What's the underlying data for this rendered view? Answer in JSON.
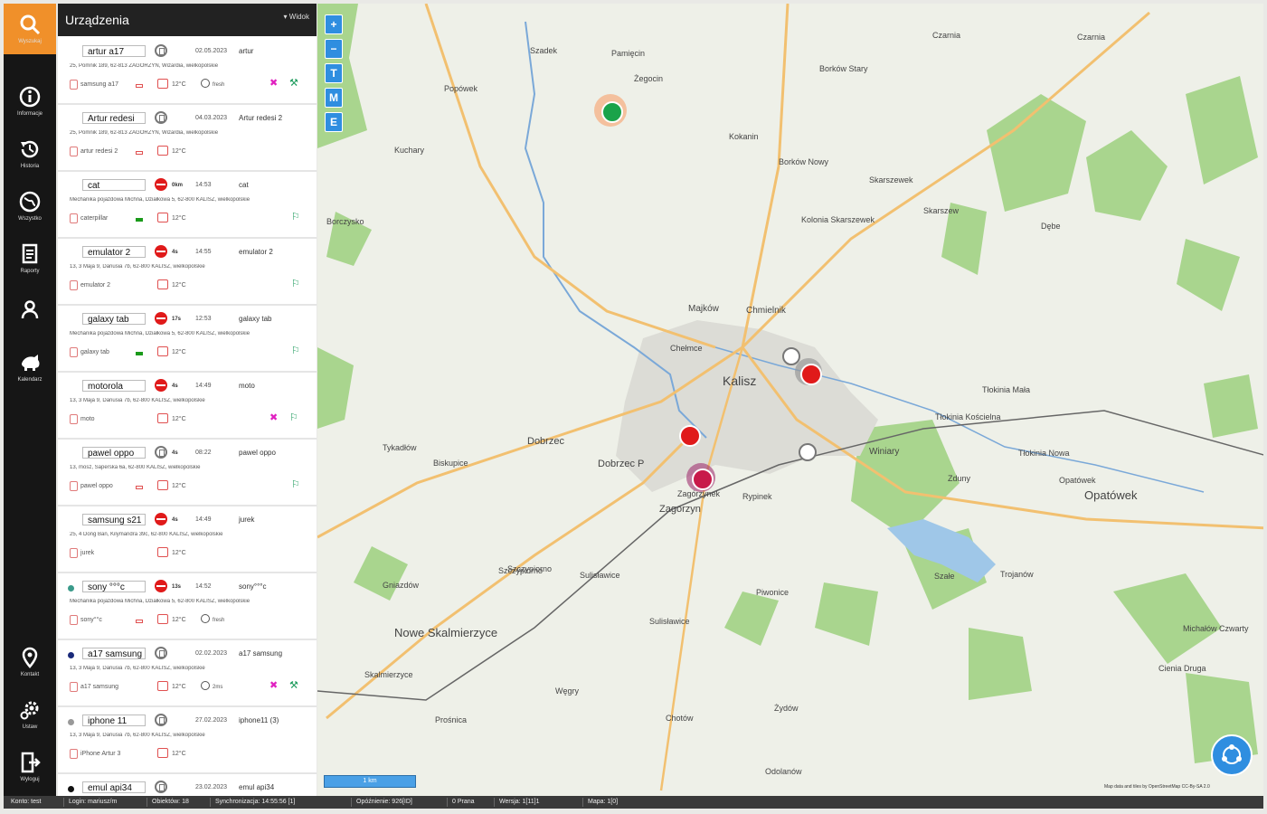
{
  "sidebar": {
    "items": [
      {
        "label": "Wyszukaj",
        "icon": "search-icon"
      },
      {
        "label": "Informacje",
        "icon": "info-icon"
      },
      {
        "label": "Historia",
        "icon": "history-icon"
      },
      {
        "label": "Wszystko",
        "icon": "globe-icon"
      },
      {
        "label": "Raporty",
        "icon": "report-icon"
      },
      {
        "label": "",
        "icon": "team-icon"
      },
      {
        "label": "Kalendarz",
        "icon": "calendar-icon"
      },
      {
        "label": "Kontakt",
        "icon": "marker-icon"
      },
      {
        "label": "Ustaw",
        "icon": "gear-icon"
      },
      {
        "label": "Wyloguj",
        "icon": "logout-icon"
      }
    ]
  },
  "panel": {
    "title": "Urządzenia",
    "view_label": "Widok"
  },
  "devices": [
    {
      "name": "artur a17",
      "time": "02.05.2023",
      "driver": "artur",
      "address": "25, Pomnik 189, 62-813 ZAGORZYN, Wizardia, wielkopolskie",
      "phone": "samsung a17",
      "temp": "12°C",
      "status": "gray",
      "battery": "red",
      "speed": "",
      "clock": "fresh",
      "dot": "",
      "tools": [
        "pin-x",
        "wrench-green"
      ]
    },
    {
      "name": "Artur redesi",
      "time": "04.03.2023",
      "driver": "Artur redesi 2",
      "address": "25, Pomnik 189, 62-813 ZAGORZYN, Wizardia, wielkopolskie",
      "phone": "artur redesi 2",
      "temp": "12°C",
      "status": "gray",
      "battery": "red",
      "speed": "",
      "clock": "",
      "dot": "",
      "tools": []
    },
    {
      "name": "cat",
      "time": "14:53",
      "driver": "cat",
      "address": "Mechanika pojazdowa Michna, Działkowa 5, 62-800 KALISZ, wielkopolskie",
      "phone": "caterpillar",
      "temp": "12°C",
      "status": "stop",
      "battery": "green",
      "speed": "0km",
      "clock": "",
      "dot": "",
      "tools": [
        "person-green"
      ]
    },
    {
      "name": "emulator 2",
      "time": "14:55",
      "driver": "emulator 2",
      "address": "13, 3 Maja 9, Danusia 7b, 62-800 KALISZ, wielkopolskie",
      "phone": "emulator 2",
      "temp": "12°C",
      "status": "stop",
      "battery": "",
      "speed": "4s",
      "clock": "",
      "dot": "",
      "tools": [
        "person-green"
      ]
    },
    {
      "name": "galaxy tab",
      "time": "12:53",
      "driver": "galaxy tab",
      "address": "Mechanika pojazdowa Michna, Działkowa 5, 62-800 KALISZ, wielkopolskie",
      "phone": "galaxy tab",
      "temp": "12°C",
      "status": "stop",
      "battery": "green",
      "speed": "17s",
      "clock": "",
      "dot": "",
      "tools": [
        "person-green"
      ]
    },
    {
      "name": "motorola",
      "time": "14:49",
      "driver": "moto",
      "address": "13, 3 Maja 9, Danusia 7b, 62-800 KALISZ, wielkopolskie",
      "phone": "moto",
      "temp": "12°C",
      "status": "stop",
      "battery": "",
      "speed": "4s",
      "clock": "",
      "dot": "",
      "tools": [
        "pin-x",
        "person-green"
      ]
    },
    {
      "name": "pawel oppo",
      "time": "08:22",
      "driver": "pawel oppo",
      "address": "13, mosz, Saperska 6a, 62-800 KALISZ, wielkopolskie",
      "phone": "pawel oppo",
      "temp": "12°C",
      "status": "gray",
      "battery": "red",
      "speed": "4s",
      "clock": "",
      "dot": "",
      "tools": [
        "person-green"
      ]
    },
    {
      "name": "samsung s21",
      "time": "14:49",
      "driver": "jurek",
      "address": "25, 4 Dong Ban, Kilymandra 39c, 62-800 KALISZ, wielkopolskie",
      "phone": "jurek",
      "temp": "12°C",
      "status": "stop",
      "battery": "",
      "speed": "4s",
      "clock": "",
      "dot": "",
      "tools": []
    },
    {
      "name": "sony °°°c",
      "time": "14:52",
      "driver": "sony°°°c",
      "address": "Mechanika pojazdowa Michna, Działkowa 5, 62-800 KALISZ, wielkopolskie",
      "phone": "sony°°c",
      "temp": "12°C",
      "status": "stop",
      "battery": "red",
      "speed": "13s",
      "clock": "fresh",
      "dot": "#3a9a8a",
      "tools": []
    },
    {
      "name": "a17 samsung",
      "time": "02.02.2023",
      "driver": "a17 samsung",
      "address": "13, 3 Maja 9, Danusia 7b, 62-800 KALISZ, wielkopolskie",
      "phone": "a17 samsung",
      "temp": "12°C",
      "status": "gray",
      "battery": "",
      "speed": "",
      "clock": "2ms",
      "dot": "#1a2a7a",
      "tools": [
        "pin-x",
        "wrench-green"
      ]
    },
    {
      "name": "iphone 11",
      "time": "27.02.2023",
      "driver": "iphone11 (3)",
      "address": "13, 3 Maja 9, Danusia 7b, 62-800 KALISZ, wielkopolskie",
      "phone": "iPhone Artur 3",
      "temp": "12°C",
      "status": "gray",
      "battery": "",
      "speed": "",
      "clock": "",
      "dot": "#999999",
      "tools": []
    },
    {
      "name": "emul api34",
      "time": "23.02.2023",
      "driver": "emul api34",
      "address": "",
      "phone": "",
      "temp": "",
      "status": "gray",
      "battery": "",
      "speed": "",
      "clock": "",
      "dot": "#111111",
      "tools": []
    }
  ],
  "map": {
    "zoom_in": "+",
    "zoom_out": "−",
    "layer_buttons": [
      "T",
      "M",
      "E"
    ],
    "scale_label": "1 km",
    "attribution": "Map data and tiles by OpenStreetMap CC-By-SA 2.0",
    "places": [
      {
        "name": "Kalisz",
        "size": "big"
      },
      {
        "name": "Nowe Skalmierzyce",
        "size": "big"
      },
      {
        "name": "Opatówek",
        "size": "big"
      },
      {
        "name": "Zagorzyn",
        "size": "mid"
      },
      {
        "name": "Szałe",
        "size": "small"
      },
      {
        "name": "Dobrzec",
        "size": "mid"
      },
      {
        "name": "Dobrzec P",
        "size": "mid"
      },
      {
        "name": "Majków",
        "size": "mid"
      },
      {
        "name": "Chmielnik",
        "size": "mid"
      },
      {
        "name": "Winiary",
        "size": "mid"
      },
      {
        "name": "Zagórzynek",
        "size": "mid"
      },
      {
        "name": "Rypinek",
        "size": "small"
      },
      {
        "name": "Sulisławice",
        "size": "small"
      },
      {
        "name": "Szczypiorno",
        "size": "small"
      },
      {
        "name": "Piwonice",
        "size": "small"
      },
      {
        "name": "Żydów",
        "size": "small"
      },
      {
        "name": "Odolanów",
        "size": "small"
      },
      {
        "name": "Czarnia",
        "size": "small"
      },
      {
        "name": "Borków Stary",
        "size": "small"
      },
      {
        "name": "Borków Nowy",
        "size": "small"
      },
      {
        "name": "Skarszewek",
        "size": "small"
      },
      {
        "name": "Skarszew",
        "size": "small"
      },
      {
        "name": "Dębe",
        "size": "small"
      },
      {
        "name": "Kolonia Skarszewek",
        "size": "small"
      },
      {
        "name": "Pamięcin",
        "size": "small"
      },
      {
        "name": "Żegocin",
        "size": "small"
      },
      {
        "name": "Szadek",
        "size": "small"
      },
      {
        "name": "Popówek",
        "size": "small"
      },
      {
        "name": "Kuchary",
        "size": "small"
      },
      {
        "name": "Borczysko",
        "size": "small"
      },
      {
        "name": "Kokanin",
        "size": "small"
      },
      {
        "name": "Chełmce",
        "size": "small"
      },
      {
        "name": "Szczypiorno",
        "size": "small"
      },
      {
        "name": "Opatówek",
        "size": "small"
      },
      {
        "name": "Tłokinia Mała",
        "size": "small"
      },
      {
        "name": "Tłokinia Kościelna",
        "size": "small"
      },
      {
        "name": "Tłokinia Nowa",
        "size": "small"
      },
      {
        "name": "Zduny",
        "size": "small"
      },
      {
        "name": "Michałów Czwarty",
        "size": "small"
      },
      {
        "name": "Cienia Druga",
        "size": "small"
      },
      {
        "name": "Trojanów",
        "size": "small"
      },
      {
        "name": "Skalmierzyce",
        "size": "small"
      },
      {
        "name": "Węgry",
        "size": "small"
      },
      {
        "name": "Biskupice",
        "size": "small"
      },
      {
        "name": "Tykadłów",
        "size": "small"
      },
      {
        "name": "Gniazdów",
        "size": "small"
      },
      {
        "name": "Sulisławice",
        "size": "small"
      },
      {
        "name": "Chotów",
        "size": "small"
      },
      {
        "name": "Prośnica",
        "size": "small"
      },
      {
        "name": "Czarnia",
        "size": "small"
      }
    ],
    "markers": [
      {
        "label": "",
        "color": "#1aa34a",
        "ring": "#f2a070"
      },
      {
        "label": "",
        "color": "#e01a1a",
        "ring": "#777777"
      },
      {
        "label": "",
        "color": "#e01a1a",
        "ring": ""
      },
      {
        "label": "",
        "color": "#c81a4a",
        "ring": "#a03070"
      },
      {
        "label": "",
        "color": "#777777",
        "ring": ""
      },
      {
        "label": "",
        "color": "#777777",
        "ring": ""
      }
    ]
  },
  "status_bar": {
    "items": [
      "Konto: test",
      "Login: mariusz/m",
      "Obiektów: 18",
      "Synchronizacja: 14:55:56 [1]",
      "Opóźnienie: 926[ID]",
      "0 Prana",
      "Wersja: 1[11]1",
      "Mapa: 1[0]"
    ]
  }
}
